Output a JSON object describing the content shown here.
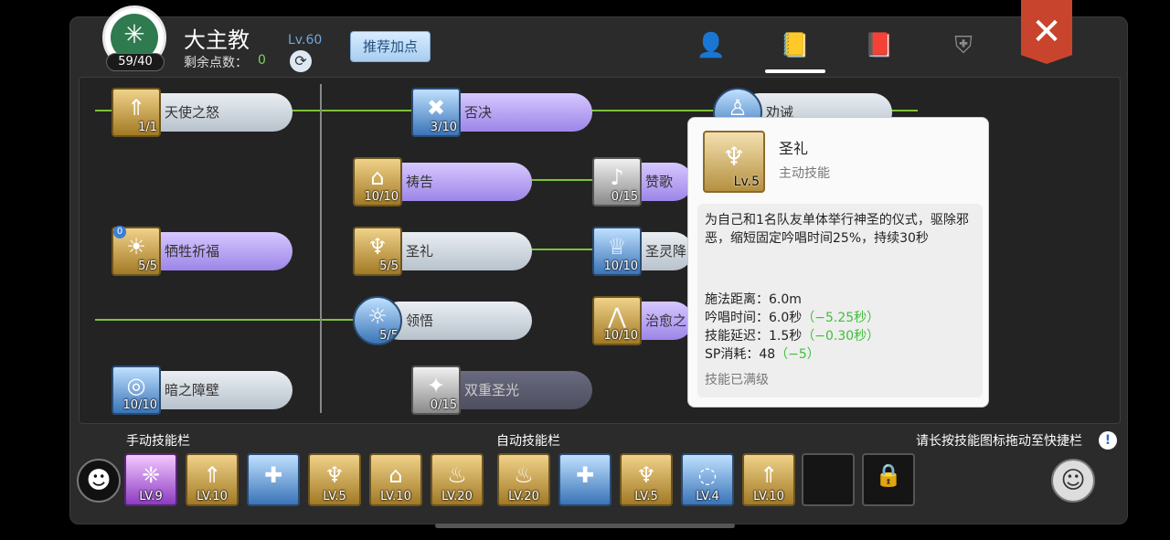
{
  "header": {
    "job_title": "大主教",
    "level": "Lv.60",
    "points_badge": "59/40",
    "remain_label": "剩余点数：",
    "remain_value": "0",
    "recommend_button": "推荐加点",
    "tabs": [
      "character-tab",
      "skill-tab",
      "book-tab",
      "guild-tab"
    ],
    "active_tab": "skill-tab",
    "close_icon": "close-icon"
  },
  "skills": [
    {
      "name": "天使之怒",
      "count": "1/1"
    },
    {
      "name": "否决",
      "count": "3/10"
    },
    {
      "name": "劝诫",
      "count": ""
    },
    {
      "name": "祷告",
      "count": "10/10"
    },
    {
      "name": "赞歌",
      "count": "0/15"
    },
    {
      "name": "牺牲祈福",
      "count": "5/5",
      "badge": "0"
    },
    {
      "name": "圣礼",
      "count": "5/5"
    },
    {
      "name": "圣灵降",
      "count": "10/10"
    },
    {
      "name": "领悟",
      "count": "5/5"
    },
    {
      "name": "治愈之",
      "count": "10/10"
    },
    {
      "name": "暗之障壁",
      "count": "10/10"
    },
    {
      "name": "双重圣光",
      "count": "0/15"
    }
  ],
  "tooltip": {
    "name": "圣礼",
    "type": "主动技能",
    "level": "Lv.5",
    "description": "为自己和1名队友单体举行神圣的仪式，驱除邪恶，缩短固定吟唱时间25%，持续30秒",
    "stats": [
      {
        "label": "施法距离：6.0m",
        "bonus": ""
      },
      {
        "label": "吟唱时间：6.0秒",
        "bonus": "（−5.25秒）"
      },
      {
        "label": "技能延迟：1.5秒",
        "bonus": "（−0.30秒）"
      },
      {
        "label": "SP消耗：48",
        "bonus": "（−5）"
      }
    ],
    "maxed": "技能已满级"
  },
  "bars": {
    "manual_label": "手动技能栏",
    "auto_label": "自动技能栏",
    "hint": "请长按技能图标拖动至快捷栏",
    "hint_icon": "!",
    "manual_slots": [
      "LV.9",
      "LV.10",
      "",
      "LV.5",
      "LV.10",
      "LV.20"
    ],
    "auto_slots": [
      "LV.20",
      "",
      "LV.5",
      "LV.4",
      "LV.10"
    ]
  }
}
